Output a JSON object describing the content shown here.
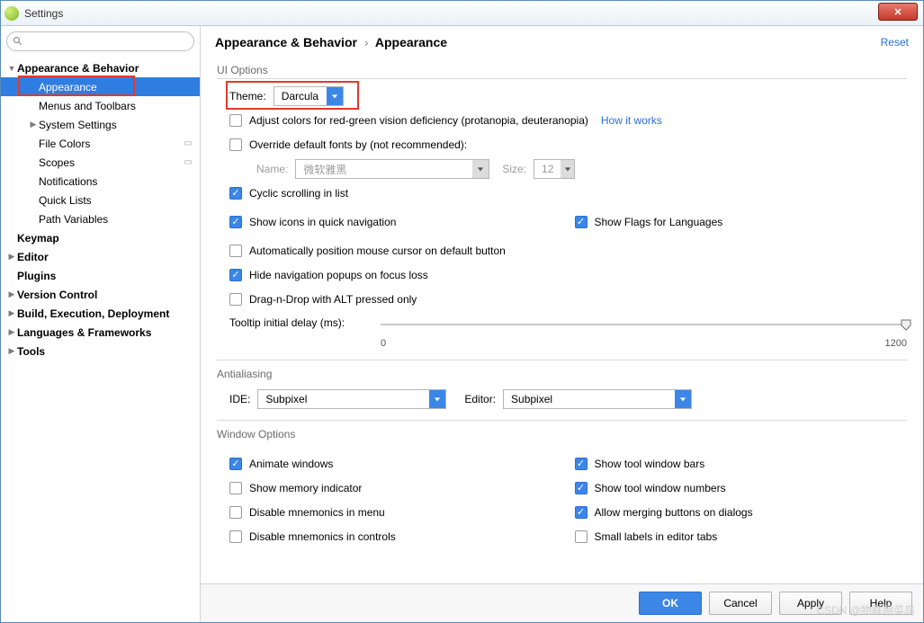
{
  "window": {
    "title": "Settings"
  },
  "sidebar": {
    "search_placeholder": "",
    "items": [
      {
        "label": "Appearance & Behavior",
        "bold": true,
        "exp": true,
        "ind": 0
      },
      {
        "label": "Appearance",
        "ind": 1,
        "selected": true
      },
      {
        "label": "Menus and Toolbars",
        "ind": 1
      },
      {
        "label": "System Settings",
        "ind": 1,
        "exp": false,
        "hasChildren": true
      },
      {
        "label": "File Colors",
        "ind": 1,
        "badge": "⇆"
      },
      {
        "label": "Scopes",
        "ind": 1,
        "badge": "⇆"
      },
      {
        "label": "Notifications",
        "ind": 1
      },
      {
        "label": "Quick Lists",
        "ind": 1
      },
      {
        "label": "Path Variables",
        "ind": 1
      },
      {
        "label": "Keymap",
        "bold": true,
        "ind": 0
      },
      {
        "label": "Editor",
        "bold": true,
        "ind": 0,
        "hasChildren": true
      },
      {
        "label": "Plugins",
        "bold": true,
        "ind": 0
      },
      {
        "label": "Version Control",
        "bold": true,
        "ind": 0,
        "hasChildren": true
      },
      {
        "label": "Build, Execution, Deployment",
        "bold": true,
        "ind": 0,
        "hasChildren": true
      },
      {
        "label": "Languages & Frameworks",
        "bold": true,
        "ind": 0,
        "hasChildren": true
      },
      {
        "label": "Tools",
        "bold": true,
        "ind": 0,
        "hasChildren": true
      }
    ]
  },
  "header": {
    "crumb_parent": "Appearance & Behavior",
    "crumb_sep": "›",
    "crumb_child": "Appearance",
    "reset": "Reset"
  },
  "ui_options": {
    "title": "UI Options",
    "theme_label": "Theme:",
    "theme_value": "Darcula",
    "adjust_colors": "Adjust colors for red-green vision deficiency (protanopia, deuteranopia)",
    "how_it_works": "How it works",
    "override_fonts": "Override default fonts by (not recommended):",
    "font_name_label": "Name:",
    "font_name_value": "微软雅黑",
    "font_size_label": "Size:",
    "font_size_value": "12",
    "cyclic_scrolling": "Cyclic scrolling in list",
    "show_icons_quick_nav": "Show icons in quick navigation",
    "show_flags_lang": "Show Flags for Languages",
    "auto_position_cursor": "Automatically position mouse cursor on default button",
    "hide_nav_popups": "Hide navigation popups on focus loss",
    "drag_n_drop_alt": "Drag-n-Drop with ALT pressed only",
    "tooltip_delay_label": "Tooltip initial delay (ms):",
    "tooltip_min": "0",
    "tooltip_max": "1200"
  },
  "antialiasing": {
    "title": "Antialiasing",
    "ide_label": "IDE:",
    "ide_value": "Subpixel",
    "editor_label": "Editor:",
    "editor_value": "Subpixel"
  },
  "window_options": {
    "title": "Window Options",
    "animate_windows": "Animate windows",
    "show_tool_window_bars": "Show tool window bars",
    "show_memory_indicator": "Show memory indicator",
    "show_tool_window_numbers": "Show tool window numbers",
    "disable_mnemonics_menu": "Disable mnemonics in menu",
    "allow_merging_buttons": "Allow merging buttons on dialogs",
    "disable_mnemonics_controls": "Disable mnemonics in controls",
    "small_labels_tabs": "Small labels in editor tabs"
  },
  "footer": {
    "ok": "OK",
    "cancel": "Cancel",
    "apply": "Apply",
    "help": "Help"
  },
  "watermark": "CSDN @物联网菜鸟"
}
